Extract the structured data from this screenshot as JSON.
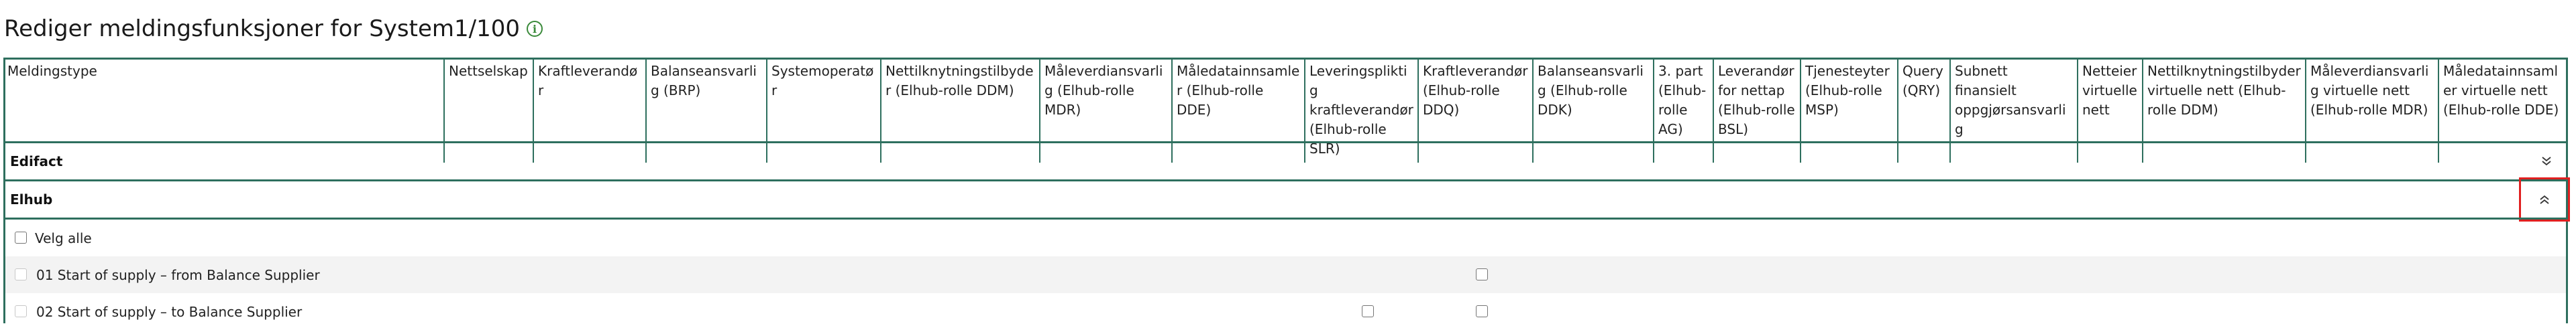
{
  "page": {
    "title": "Rediger meldingsfunksjoner for System1/100",
    "info_icon": "info-icon"
  },
  "table": {
    "columns": [
      "Meldingstype",
      "Nettselskap",
      "Kraftleverandør",
      "Balanseansvarlig (BRP)",
      "Systemoperatør",
      "Nettilknytningstilbyder (Elhub-rolle DDM)",
      "Måleverdiansvarlig (Elhub-rolle MDR)",
      "Måledatainnsamler (Elhub-rolle DDE)",
      "Leveringspliktig kraftleverandør (Elhub-rolle SLR)",
      "Kraftleverandør (Elhub-rolle DDQ)",
      "Balanseansvarlig (Elhub-rolle DDK)",
      "3. part (Elhub-rolle AG)",
      "Leverandør for nettap (Elhub-rolle BSL)",
      "Tjenesteyter (Elhub-rolle MSP)",
      "Query (QRY)",
      "Subnett finansielt oppgjørsansvarlig",
      "Netteier virtuelle nett",
      "Nettilknytningstilbyder virtuelle nett (Elhub-rolle DDM)",
      "Måleverdiansvarlig virtuelle nett (Elhub-rolle MDR)",
      "Måledatainnsamler virtuelle nett (Elhub-rolle DDE)"
    ]
  },
  "sections": {
    "edifact": {
      "label": "Edifact",
      "icon": "chevron-double-down-icon"
    },
    "elhub": {
      "label": "Elhub",
      "icon": "chevron-double-up-icon"
    }
  },
  "rows": {
    "select_all": {
      "label": "Velg alle"
    },
    "items": [
      {
        "label": "01 Start of supply – from Balance Supplier"
      },
      {
        "label": "02 Start of supply – to Balance Supplier"
      }
    ]
  }
}
